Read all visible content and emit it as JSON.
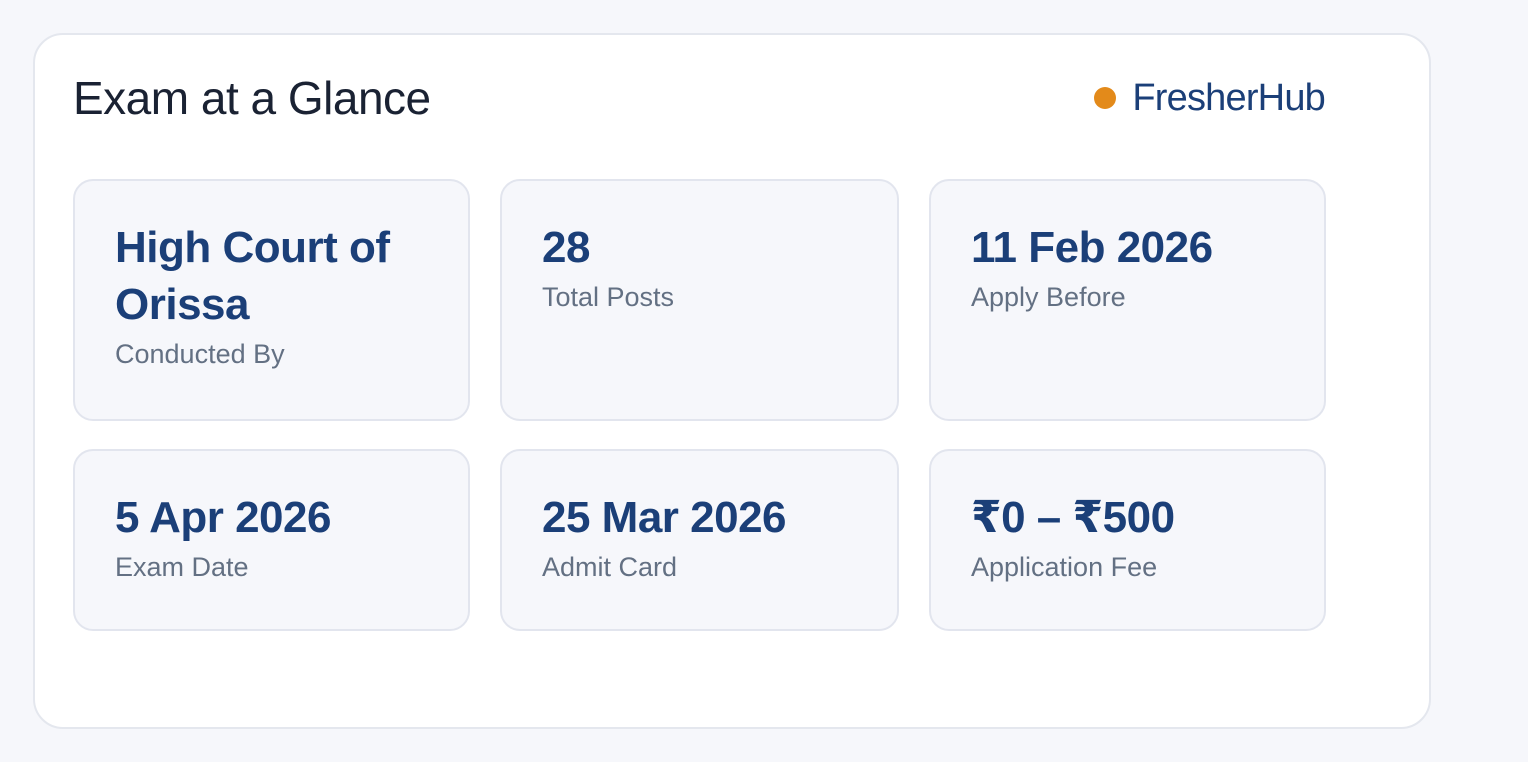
{
  "header": {
    "title": "Exam at a Glance",
    "brand_name": "FresherHub",
    "brand_dot_color": "#e38a1a"
  },
  "tiles": [
    {
      "value": "High Court of Orissa",
      "label": "Conducted By"
    },
    {
      "value": "28",
      "label": "Total Posts"
    },
    {
      "value": "11 Feb 2026",
      "label": "Apply Before"
    },
    {
      "value": "5 Apr 2026",
      "label": "Exam Date"
    },
    {
      "value": "25 Mar 2026",
      "label": "Admit Card"
    },
    {
      "value": "₹0 – ₹500",
      "label": "Application Fee"
    }
  ],
  "colors": {
    "accent": "#1b3f78",
    "label": "#637083",
    "background": "#f6f7fb"
  }
}
